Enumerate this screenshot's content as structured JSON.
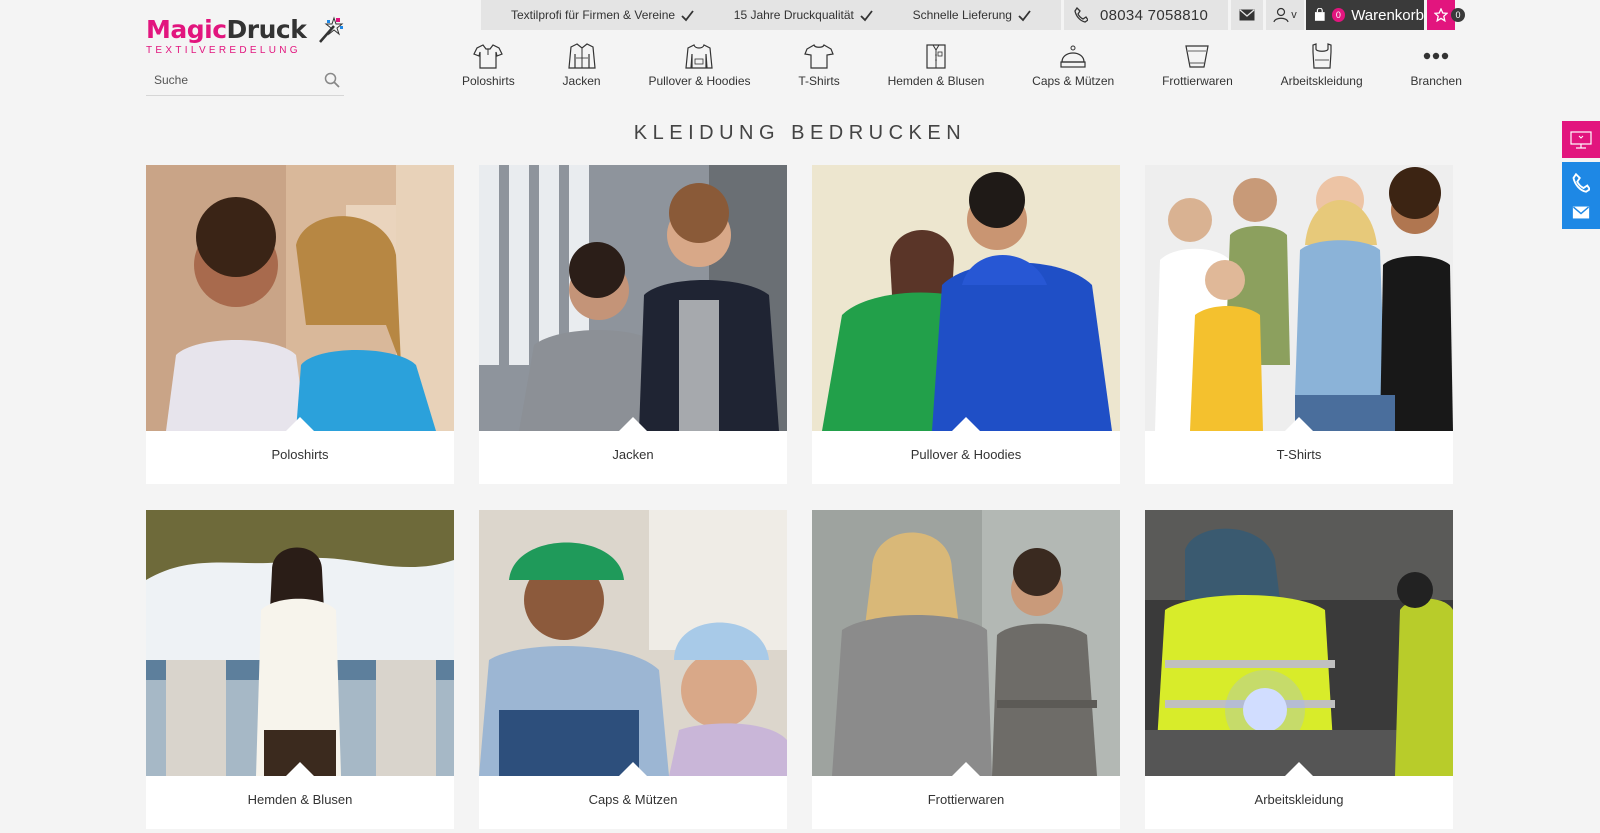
{
  "brand": {
    "name_part1": "Magic",
    "name_part2": "Druck",
    "tagline": "TEXTILVEREDELUNG",
    "pink": "#e2157e",
    "dark": "#3a3a3a"
  },
  "search": {
    "placeholder": "Suche",
    "icon": "search-icon"
  },
  "topbar": {
    "usps": [
      "Textilprofi für Firmen & Vereine",
      "15 Jahre Druckqualität",
      "Schnelle Lieferung"
    ],
    "phone": "08034 7058810",
    "account_chevron": "v",
    "cart_label": "Warenkorb",
    "cart_count": "0",
    "wishlist_count": "0"
  },
  "nav": {
    "items": [
      {
        "label": "Poloshirts",
        "icon": "polo-icon"
      },
      {
        "label": "Jacken",
        "icon": "jacket-icon"
      },
      {
        "label": "Pullover & Hoodies",
        "icon": "hoodie-icon"
      },
      {
        "label": "T-Shirts",
        "icon": "tshirt-icon"
      },
      {
        "label": "Hemden & Blusen",
        "icon": "shirt-icon"
      },
      {
        "label": "Caps & Mützen",
        "icon": "cap-icon"
      },
      {
        "label": "Frottierwaren",
        "icon": "towel-icon"
      },
      {
        "label": "Arbeitskleidung",
        "icon": "workwear-icon"
      },
      {
        "label": "Branchen",
        "icon": "more-icon"
      }
    ]
  },
  "page": {
    "title": "KLEIDUNG BEDRUCKEN"
  },
  "categories": [
    {
      "label": "Poloshirts"
    },
    {
      "label": "Jacken"
    },
    {
      "label": "Pullover & Hoodies"
    },
    {
      "label": "T-Shirts"
    },
    {
      "label": "Hemden & Blusen"
    },
    {
      "label": "Caps & Mützen"
    },
    {
      "label": "Frottierwaren"
    },
    {
      "label": "Arbeitskleidung"
    }
  ],
  "side": {
    "accent_blue": "#1e88e5"
  }
}
